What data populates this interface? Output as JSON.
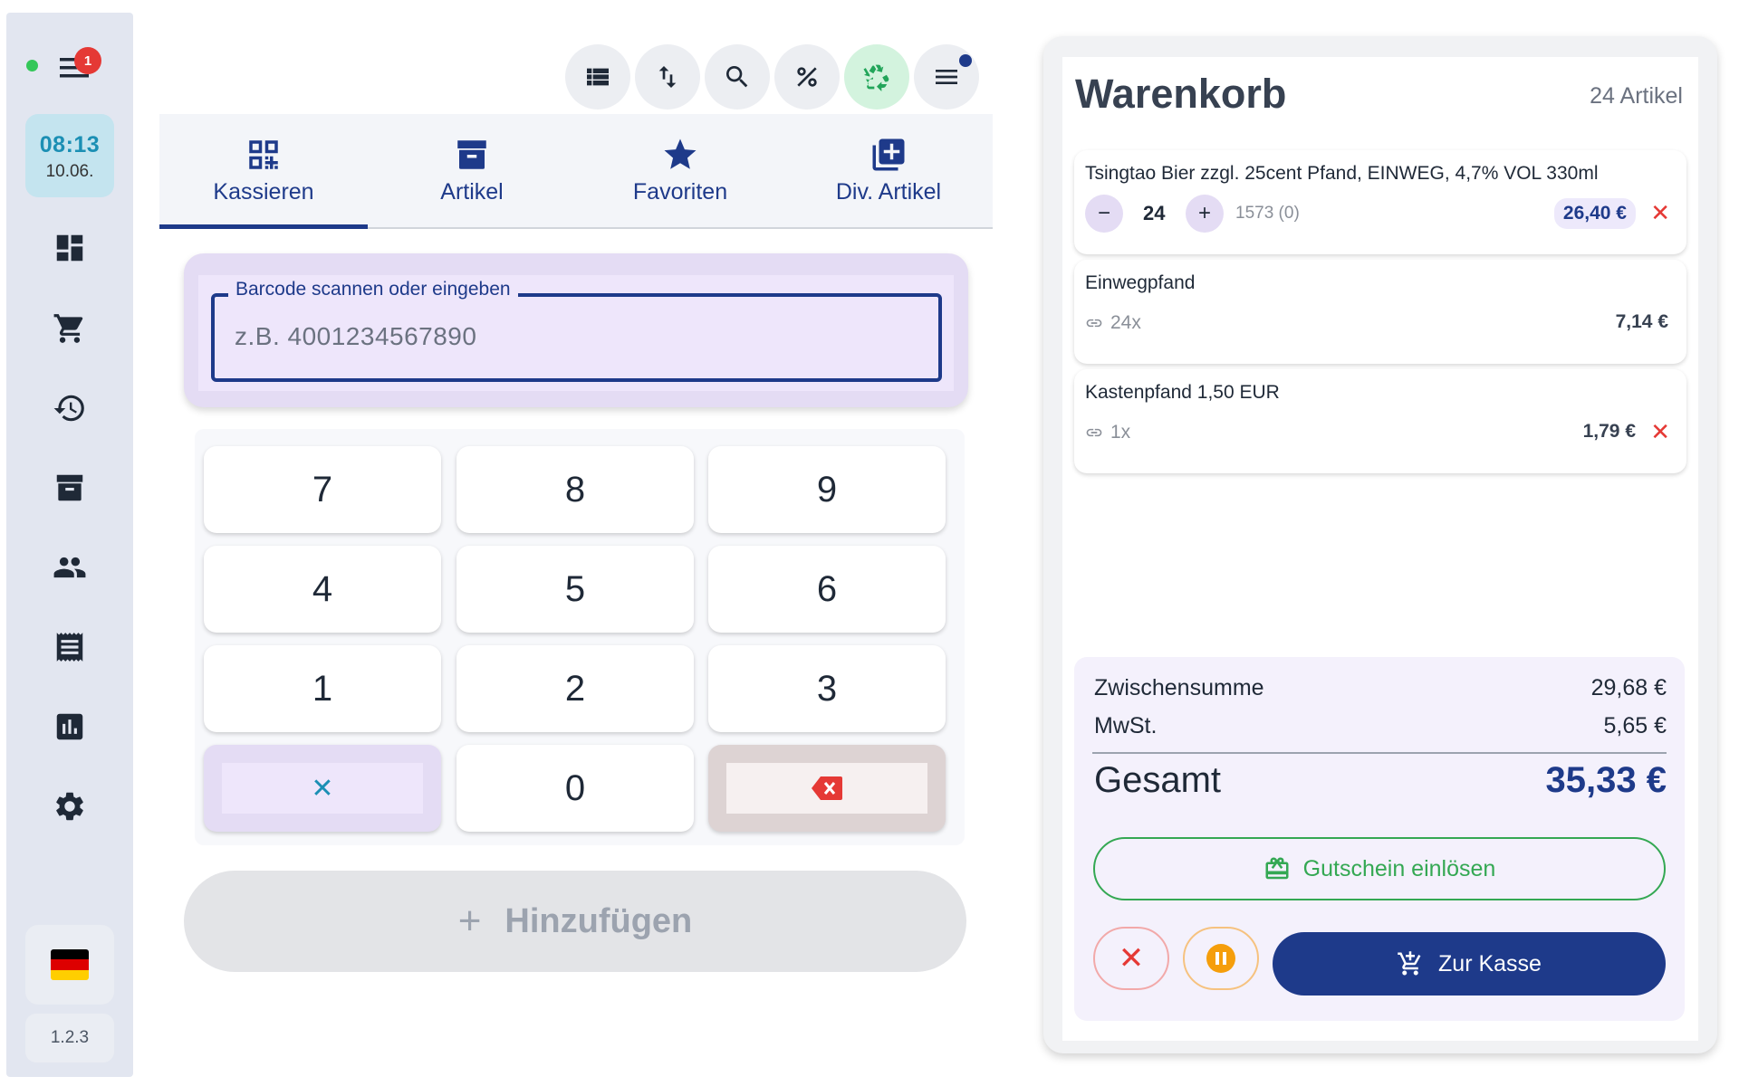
{
  "sidebar": {
    "notification_count": "1",
    "clock": {
      "time": "08:13",
      "date": "10.06."
    },
    "nav_icons": [
      "dashboard-icon",
      "cart-icon",
      "history-icon",
      "archive-icon",
      "people-icon",
      "receipt-icon",
      "report-icon",
      "settings-icon"
    ],
    "language": "de",
    "version": "1.2.3"
  },
  "toolbar": {
    "icons": [
      "list-icon",
      "sort-icon",
      "search-icon",
      "percent-icon",
      "recycle-icon",
      "menu-icon"
    ]
  },
  "tabs": [
    {
      "label": "Kassieren",
      "icon": "qr-code-icon",
      "active": true
    },
    {
      "label": "Artikel",
      "icon": "archive-icon",
      "active": false
    },
    {
      "label": "Favoriten",
      "icon": "star-icon",
      "active": false
    },
    {
      "label": "Div. Artikel",
      "icon": "add-box-icon",
      "active": false
    }
  ],
  "barcode": {
    "label": "Barcode scannen oder eingeben",
    "placeholder": "z.B. 4001234567890",
    "value": ""
  },
  "keypad": {
    "keys": [
      "7",
      "8",
      "9",
      "4",
      "5",
      "6",
      "1",
      "2",
      "3",
      "0"
    ],
    "clear_symbol": "✕",
    "add_label": "Hinzufügen"
  },
  "cart": {
    "title": "Warenkorb",
    "count_label": "24 Artikel",
    "items": [
      {
        "name": "Tsingtao Bier zzgl. 25cent Pfand, EINWEG, 4,7% VOL 330ml",
        "qty": "24",
        "stock": "1573 (0)",
        "price": "26,40 €"
      },
      {
        "name": "Einwegpfand",
        "link_qty": "24x",
        "price": "7,14 €"
      },
      {
        "name": "Kastenpfand 1,50 EUR",
        "link_qty": "1x",
        "price": "1,79 €"
      }
    ],
    "totals": {
      "subtotal_label": "Zwischensumme",
      "subtotal": "29,68 €",
      "tax_label": "MwSt.",
      "tax": "5,65 €",
      "total_label": "Gesamt",
      "total": "35,33 €"
    },
    "voucher_label": "Gutschein einlösen",
    "checkout_label": "Zur Kasse"
  },
  "colors": {
    "primary": "#1e3a8a",
    "accent_teal": "#1b8fb4",
    "success": "#34a853",
    "danger": "#e53935",
    "warning": "#f59e0b"
  }
}
